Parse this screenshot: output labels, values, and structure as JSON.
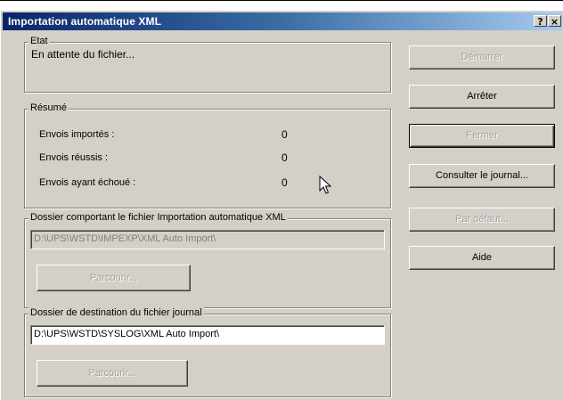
{
  "window": {
    "title": "Importation automatique XML",
    "help_label": "?",
    "close_label": "×"
  },
  "etat": {
    "legend": "Etat",
    "status": "En attente du fichier..."
  },
  "resume": {
    "legend": "Résumé",
    "rows": [
      {
        "label": "Envois importés :",
        "value": "0"
      },
      {
        "label": "Envois réussis :",
        "value": "0"
      },
      {
        "label": "Envois ayant échoué :",
        "value": "0"
      }
    ]
  },
  "import_folder": {
    "legend": "Dossier comportant le fichier Importation automatique XML",
    "path": "D:\\UPS\\WSTD\\IMPEXP\\XML Auto Import\\",
    "browse_label": "Parcourir..."
  },
  "log_folder": {
    "legend": "Dossier de destination du fichier journal",
    "path": "D:\\UPS\\WSTD\\SYSLOG\\XML Auto Import\\",
    "browse_label": "Parcourir..."
  },
  "buttons": {
    "start": "Démarrer",
    "stop": "Arrêter",
    "close": "Fermer",
    "view_log": "Consulter le journal...",
    "defaults": "Par défaut...",
    "help": "Aide"
  },
  "colors": {
    "dialog_bg": "#d4d0c8",
    "title_start": "#0a246a",
    "title_end": "#a6caf0",
    "disabled_text": "#a0a0a0"
  }
}
